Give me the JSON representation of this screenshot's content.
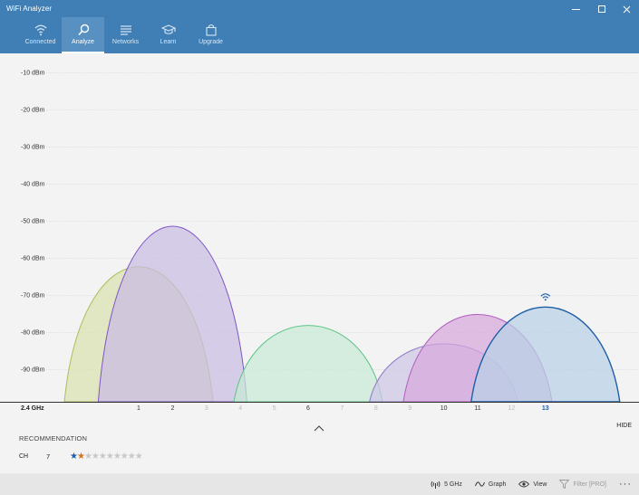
{
  "window": {
    "title": "WiFi Analyzer",
    "minimize_glyph": "—",
    "maximize_glyph": "☐",
    "close_glyph": "✕"
  },
  "nav": [
    {
      "key": "connected",
      "label": "Connected",
      "icon": "wifi-icon",
      "active": false
    },
    {
      "key": "analyze",
      "label": "Analyze",
      "icon": "search-icon",
      "active": true
    },
    {
      "key": "networks",
      "label": "Networks",
      "icon": "list-icon",
      "active": false
    },
    {
      "key": "learn",
      "label": "Learn",
      "icon": "graduation-cap-icon",
      "active": false
    },
    {
      "key": "upgrade",
      "label": "Upgrade",
      "icon": "shopping-bag-icon",
      "active": false
    }
  ],
  "chart_data": {
    "type": "area",
    "band_label": "2.4 GHz",
    "ylim": [
      -100,
      -5
    ],
    "y_ticks": [
      {
        "value": -10,
        "label": "-10 dBm"
      },
      {
        "value": -20,
        "label": "-20 dBm"
      },
      {
        "value": -30,
        "label": "-30 dBm"
      },
      {
        "value": -40,
        "label": "-40 dBm"
      },
      {
        "value": -50,
        "label": "-50 dBm"
      },
      {
        "value": -60,
        "label": "-60 dBm"
      },
      {
        "value": -70,
        "label": "-70 dBm"
      },
      {
        "value": -80,
        "label": "-80 dBm"
      },
      {
        "value": -90,
        "label": "-90 dBm"
      }
    ],
    "x_ticks": [
      {
        "channel": 1,
        "label": "1",
        "strong": true
      },
      {
        "channel": 2,
        "label": "2",
        "strong": true
      },
      {
        "channel": 3,
        "label": "3",
        "strong": false
      },
      {
        "channel": 4,
        "label": "4",
        "strong": false
      },
      {
        "channel": 5,
        "label": "5",
        "strong": false
      },
      {
        "channel": 6,
        "label": "6",
        "strong": true
      },
      {
        "channel": 7,
        "label": "7",
        "strong": false
      },
      {
        "channel": 8,
        "label": "8",
        "strong": false
      },
      {
        "channel": 9,
        "label": "9",
        "strong": false
      },
      {
        "channel": 10,
        "label": "10",
        "strong": true
      },
      {
        "channel": 11,
        "label": "11",
        "strong": true
      },
      {
        "channel": 12,
        "label": "12",
        "strong": false
      },
      {
        "channel": 13,
        "label": "13",
        "strong": true,
        "highlight": true
      }
    ],
    "series": [
      {
        "channel": 1,
        "peak_dbm": -62,
        "fill": "#d9e2b0",
        "stroke": "#a9bf5a",
        "connected": false
      },
      {
        "channel": 2,
        "peak_dbm": -51,
        "fill": "#c9bde3",
        "stroke": "#7e55c4",
        "connected": false
      },
      {
        "channel": 6,
        "peak_dbm": -78,
        "fill": "#c7ead5",
        "stroke": "#5bc484",
        "connected": false
      },
      {
        "channel": 10,
        "peak_dbm": -83,
        "fill": "#cfc6e6",
        "stroke": "#8e78c8",
        "connected": false
      },
      {
        "channel": 11,
        "peak_dbm": -75,
        "fill": "#d7a8dc",
        "stroke": "#b35dc1",
        "connected": false
      },
      {
        "channel": 13,
        "peak_dbm": -73,
        "fill": "#b9d1e6",
        "stroke": "#1f5fa8",
        "connected": true
      }
    ],
    "grid": true,
    "accent": "#1f5fa8"
  },
  "panel": {
    "collapse_icon": "chevron-up-icon",
    "hide_label": "HIDE",
    "recommendation_title": "RECOMMENDATION",
    "ch_label": "CH",
    "ch_value": "7",
    "rating": 2,
    "rating_max": 10
  },
  "statusbar": [
    {
      "key": "band",
      "label": "5 GHz",
      "icon": "antenna-icon",
      "disabled": false
    },
    {
      "key": "graph",
      "label": "Graph",
      "icon": "graph-icon",
      "disabled": false
    },
    {
      "key": "view",
      "label": "View",
      "icon": "eye-icon",
      "disabled": false
    },
    {
      "key": "filter",
      "label": "Filter [PRO]",
      "icon": "filter-icon",
      "disabled": true
    },
    {
      "key": "more",
      "label": "···",
      "icon": "more-icon",
      "disabled": false
    }
  ],
  "colors": {
    "titlebar": "#3f7fb6",
    "nav_active": "#5790c1",
    "star_blue": "#1f5fa8",
    "star_orange": "#d6731f",
    "star_empty": "#c8c8c8"
  }
}
